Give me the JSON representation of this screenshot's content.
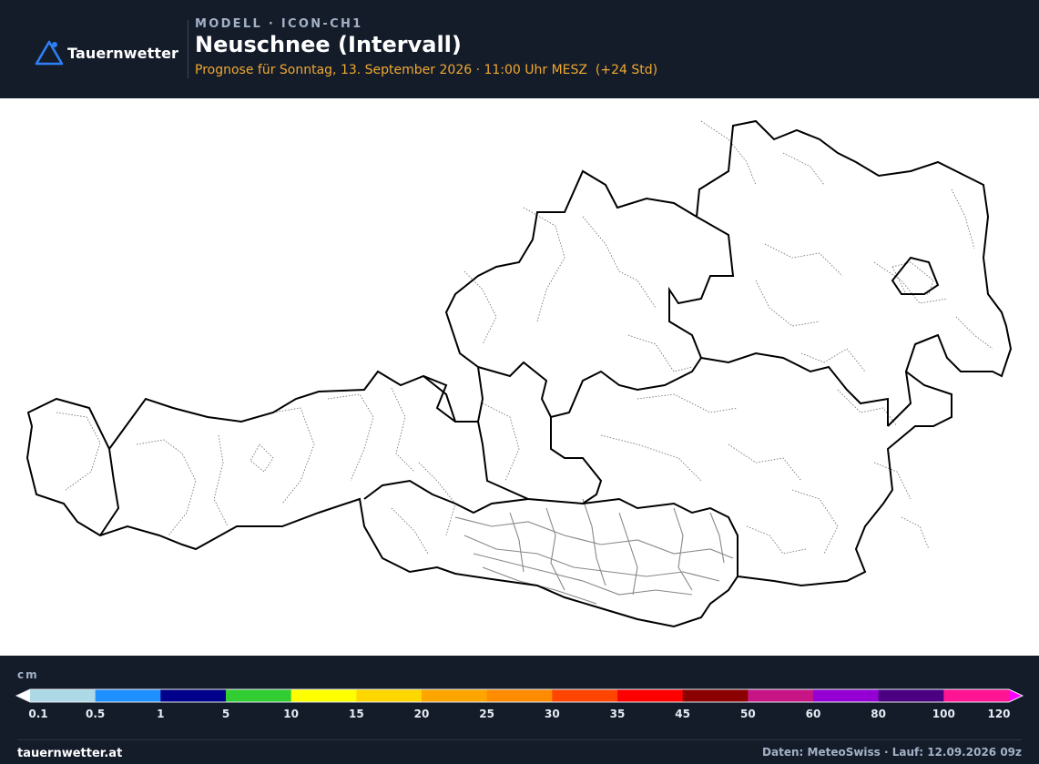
{
  "header": {
    "brand": "Tauernwetter",
    "model": "MODELL · ICON-CH1",
    "title": "Neuschnee (Intervall)",
    "subtitle": "Prognose für Sonntag, 13. September 2026 · 11:00 Uhr MESZ  (+24 Std)"
  },
  "legend": {
    "unit": "cm",
    "ticks": [
      "0.1",
      "0.5",
      "1",
      "5",
      "10",
      "15",
      "20",
      "25",
      "30",
      "35",
      "45",
      "50",
      "60",
      "80",
      "100",
      "120"
    ],
    "colors": [
      "#add8e6",
      "#1e90ff",
      "#00008b",
      "#32cd32",
      "#ffff00",
      "#ffd700",
      "#ffa500",
      "#ff8c00",
      "#ff4500",
      "#ff0000",
      "#8b0000",
      "#c71585",
      "#9400d3",
      "#4b0082",
      "#ff1493"
    ],
    "under_color": "#ffffff",
    "over_color": "#ff00ff"
  },
  "map": {
    "region": "Austria",
    "layers": [
      "state-borders",
      "district-borders",
      "municipal-borders",
      "rivers"
    ],
    "snow_cells": []
  },
  "footer": {
    "site": "tauernwetter.at",
    "source": "Daten: MeteoSwiss · Lauf: 12.09.2026 09z"
  },
  "colors": {
    "background": "#141c2a",
    "accent": "#f0a830",
    "muted": "#a3b1c6",
    "brand": "#2f7ff5"
  }
}
